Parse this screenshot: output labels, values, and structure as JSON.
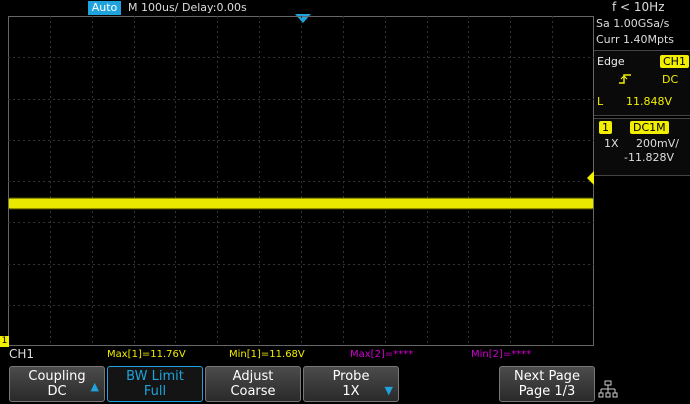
{
  "top": {
    "run_mode": "Auto",
    "timebase": "M 100us/",
    "delay": "Delay:0.00s"
  },
  "info": {
    "frequency": "f < 10Hz",
    "sample_rate": "Sa 1.00GSa/s",
    "curr_memory": "Curr 1.40Mpts"
  },
  "trigger": {
    "type": "Edge",
    "source": "CH1",
    "slope_icon": "rising-edge-icon",
    "coupling": "DC",
    "level_label": "L",
    "level": "11.848V"
  },
  "channel": {
    "number": "1",
    "coupling_impedance": "DC1M",
    "probe": "1X",
    "scale": "200mV/",
    "offset": "-11.828V"
  },
  "measurements": {
    "channel": "CH1",
    "max1": "Max[1]=11.76V",
    "min1": "Min[1]=11.68V",
    "max2": "Max[2]=****",
    "min2": "Min[2]=****"
  },
  "softkeys": {
    "coupling_line1": "Coupling",
    "coupling_line2": "DC",
    "bw_line1": "BW Limit",
    "bw_line2": "Full",
    "adjust_line1": "Adjust",
    "adjust_line2": "Coarse",
    "probe_line1": "Probe",
    "probe_line2": "1X",
    "next_line1": "Next Page",
    "next_line2": "Page 1/3"
  },
  "colors": {
    "ch1": "#f2ee00",
    "accent": "#1ea3dc",
    "math": "#d000d0"
  }
}
